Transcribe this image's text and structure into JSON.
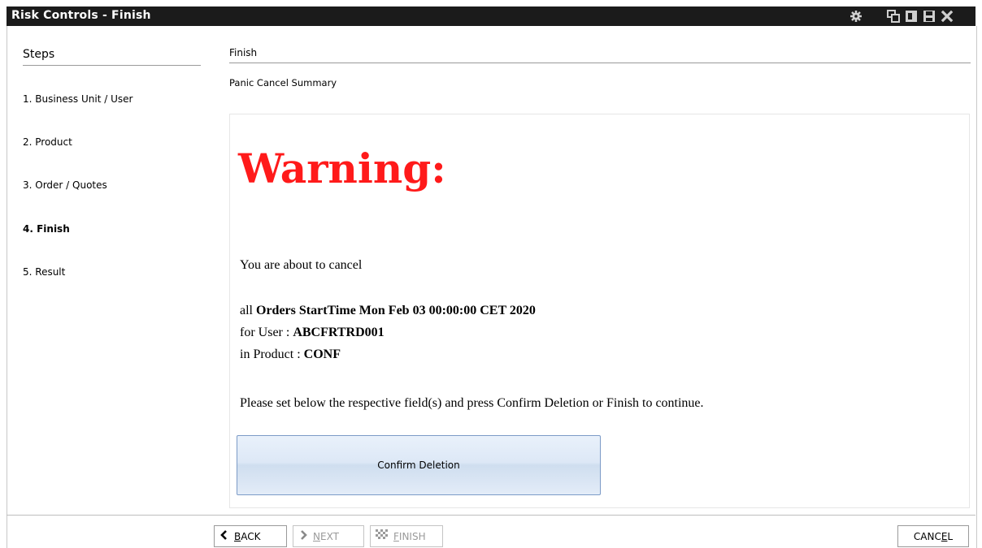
{
  "window": {
    "title": "Risk Controls - Finish",
    "icons": [
      "settings-gear-icon",
      "restore-window-icon",
      "detach-window-icon",
      "save-window-icon",
      "close-icon"
    ]
  },
  "steps": {
    "title": "Steps",
    "items": [
      {
        "label": "1. Business Unit / User",
        "active": false
      },
      {
        "label": "2. Product",
        "active": false
      },
      {
        "label": "3. Order / Quotes",
        "active": false
      },
      {
        "label": "4. Finish",
        "active": true
      },
      {
        "label": "5. Result",
        "active": false
      }
    ]
  },
  "main": {
    "title": "Finish",
    "subtitle": "Panic Cancel Summary",
    "warning": "Warning:",
    "intro": "You are about to cancel",
    "line1_prefix": "all",
    "line1_bold": "Orders StartTime Mon Feb 03 00:00:00 CET 2020",
    "line2_prefix": "for User :",
    "line2_bold": "ABCFRTRD001",
    "line3_prefix": "in Product :",
    "line3_bold": "CONF",
    "instruction": "Please set below the respective field(s) and press Confirm Deletion or Finish to continue.",
    "confirm_button": "Confirm Deletion"
  },
  "footer": {
    "back": {
      "pre": "",
      "ul": "B",
      "post": "ACK"
    },
    "next": {
      "pre": "",
      "ul": "N",
      "post": "EXT"
    },
    "finish": {
      "pre": "",
      "ul": "F",
      "post": "INISH"
    },
    "cancel": {
      "pre": "CANC",
      "ul": "E",
      "post": "L"
    }
  },
  "colors": {
    "titlebar": "#1b1b1b",
    "warning": "#ff1a1a",
    "button_border": "#7c9bc7"
  }
}
